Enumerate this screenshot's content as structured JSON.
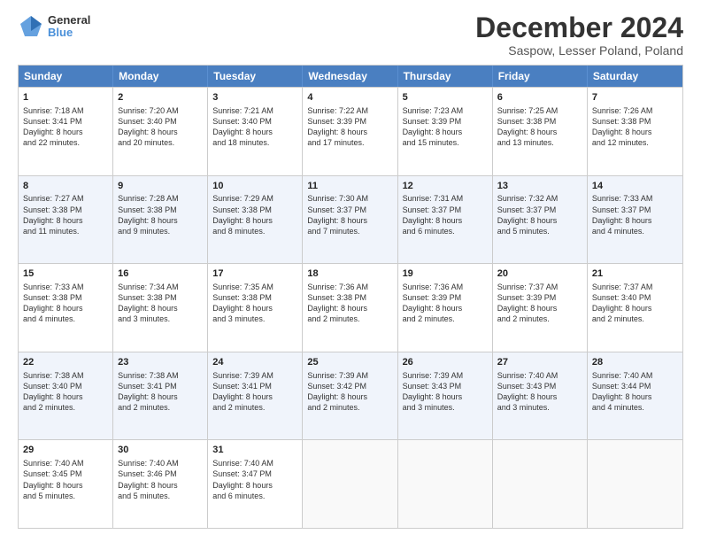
{
  "logo": {
    "general": "General",
    "blue": "Blue"
  },
  "header": {
    "title": "December 2024",
    "location": "Saspow, Lesser Poland, Poland"
  },
  "weekdays": [
    "Sunday",
    "Monday",
    "Tuesday",
    "Wednesday",
    "Thursday",
    "Friday",
    "Saturday"
  ],
  "rows": [
    [
      {
        "day": "1",
        "lines": [
          "Sunrise: 7:18 AM",
          "Sunset: 3:41 PM",
          "Daylight: 8 hours",
          "and 22 minutes."
        ]
      },
      {
        "day": "2",
        "lines": [
          "Sunrise: 7:20 AM",
          "Sunset: 3:40 PM",
          "Daylight: 8 hours",
          "and 20 minutes."
        ]
      },
      {
        "day": "3",
        "lines": [
          "Sunrise: 7:21 AM",
          "Sunset: 3:40 PM",
          "Daylight: 8 hours",
          "and 18 minutes."
        ]
      },
      {
        "day": "4",
        "lines": [
          "Sunrise: 7:22 AM",
          "Sunset: 3:39 PM",
          "Daylight: 8 hours",
          "and 17 minutes."
        ]
      },
      {
        "day": "5",
        "lines": [
          "Sunrise: 7:23 AM",
          "Sunset: 3:39 PM",
          "Daylight: 8 hours",
          "and 15 minutes."
        ]
      },
      {
        "day": "6",
        "lines": [
          "Sunrise: 7:25 AM",
          "Sunset: 3:38 PM",
          "Daylight: 8 hours",
          "and 13 minutes."
        ]
      },
      {
        "day": "7",
        "lines": [
          "Sunrise: 7:26 AM",
          "Sunset: 3:38 PM",
          "Daylight: 8 hours",
          "and 12 minutes."
        ]
      }
    ],
    [
      {
        "day": "8",
        "lines": [
          "Sunrise: 7:27 AM",
          "Sunset: 3:38 PM",
          "Daylight: 8 hours",
          "and 11 minutes."
        ]
      },
      {
        "day": "9",
        "lines": [
          "Sunrise: 7:28 AM",
          "Sunset: 3:38 PM",
          "Daylight: 8 hours",
          "and 9 minutes."
        ]
      },
      {
        "day": "10",
        "lines": [
          "Sunrise: 7:29 AM",
          "Sunset: 3:38 PM",
          "Daylight: 8 hours",
          "and 8 minutes."
        ]
      },
      {
        "day": "11",
        "lines": [
          "Sunrise: 7:30 AM",
          "Sunset: 3:37 PM",
          "Daylight: 8 hours",
          "and 7 minutes."
        ]
      },
      {
        "day": "12",
        "lines": [
          "Sunrise: 7:31 AM",
          "Sunset: 3:37 PM",
          "Daylight: 8 hours",
          "and 6 minutes."
        ]
      },
      {
        "day": "13",
        "lines": [
          "Sunrise: 7:32 AM",
          "Sunset: 3:37 PM",
          "Daylight: 8 hours",
          "and 5 minutes."
        ]
      },
      {
        "day": "14",
        "lines": [
          "Sunrise: 7:33 AM",
          "Sunset: 3:37 PM",
          "Daylight: 8 hours",
          "and 4 minutes."
        ]
      }
    ],
    [
      {
        "day": "15",
        "lines": [
          "Sunrise: 7:33 AM",
          "Sunset: 3:38 PM",
          "Daylight: 8 hours",
          "and 4 minutes."
        ]
      },
      {
        "day": "16",
        "lines": [
          "Sunrise: 7:34 AM",
          "Sunset: 3:38 PM",
          "Daylight: 8 hours",
          "and 3 minutes."
        ]
      },
      {
        "day": "17",
        "lines": [
          "Sunrise: 7:35 AM",
          "Sunset: 3:38 PM",
          "Daylight: 8 hours",
          "and 3 minutes."
        ]
      },
      {
        "day": "18",
        "lines": [
          "Sunrise: 7:36 AM",
          "Sunset: 3:38 PM",
          "Daylight: 8 hours",
          "and 2 minutes."
        ]
      },
      {
        "day": "19",
        "lines": [
          "Sunrise: 7:36 AM",
          "Sunset: 3:39 PM",
          "Daylight: 8 hours",
          "and 2 minutes."
        ]
      },
      {
        "day": "20",
        "lines": [
          "Sunrise: 7:37 AM",
          "Sunset: 3:39 PM",
          "Daylight: 8 hours",
          "and 2 minutes."
        ]
      },
      {
        "day": "21",
        "lines": [
          "Sunrise: 7:37 AM",
          "Sunset: 3:40 PM",
          "Daylight: 8 hours",
          "and 2 minutes."
        ]
      }
    ],
    [
      {
        "day": "22",
        "lines": [
          "Sunrise: 7:38 AM",
          "Sunset: 3:40 PM",
          "Daylight: 8 hours",
          "and 2 minutes."
        ]
      },
      {
        "day": "23",
        "lines": [
          "Sunrise: 7:38 AM",
          "Sunset: 3:41 PM",
          "Daylight: 8 hours",
          "and 2 minutes."
        ]
      },
      {
        "day": "24",
        "lines": [
          "Sunrise: 7:39 AM",
          "Sunset: 3:41 PM",
          "Daylight: 8 hours",
          "and 2 minutes."
        ]
      },
      {
        "day": "25",
        "lines": [
          "Sunrise: 7:39 AM",
          "Sunset: 3:42 PM",
          "Daylight: 8 hours",
          "and 2 minutes."
        ]
      },
      {
        "day": "26",
        "lines": [
          "Sunrise: 7:39 AM",
          "Sunset: 3:43 PM",
          "Daylight: 8 hours",
          "and 3 minutes."
        ]
      },
      {
        "day": "27",
        "lines": [
          "Sunrise: 7:40 AM",
          "Sunset: 3:43 PM",
          "Daylight: 8 hours",
          "and 3 minutes."
        ]
      },
      {
        "day": "28",
        "lines": [
          "Sunrise: 7:40 AM",
          "Sunset: 3:44 PM",
          "Daylight: 8 hours",
          "and 4 minutes."
        ]
      }
    ],
    [
      {
        "day": "29",
        "lines": [
          "Sunrise: 7:40 AM",
          "Sunset: 3:45 PM",
          "Daylight: 8 hours",
          "and 5 minutes."
        ]
      },
      {
        "day": "30",
        "lines": [
          "Sunrise: 7:40 AM",
          "Sunset: 3:46 PM",
          "Daylight: 8 hours",
          "and 5 minutes."
        ]
      },
      {
        "day": "31",
        "lines": [
          "Sunrise: 7:40 AM",
          "Sunset: 3:47 PM",
          "Daylight: 8 hours",
          "and 6 minutes."
        ]
      },
      {
        "day": "",
        "lines": []
      },
      {
        "day": "",
        "lines": []
      },
      {
        "day": "",
        "lines": []
      },
      {
        "day": "",
        "lines": []
      }
    ]
  ]
}
